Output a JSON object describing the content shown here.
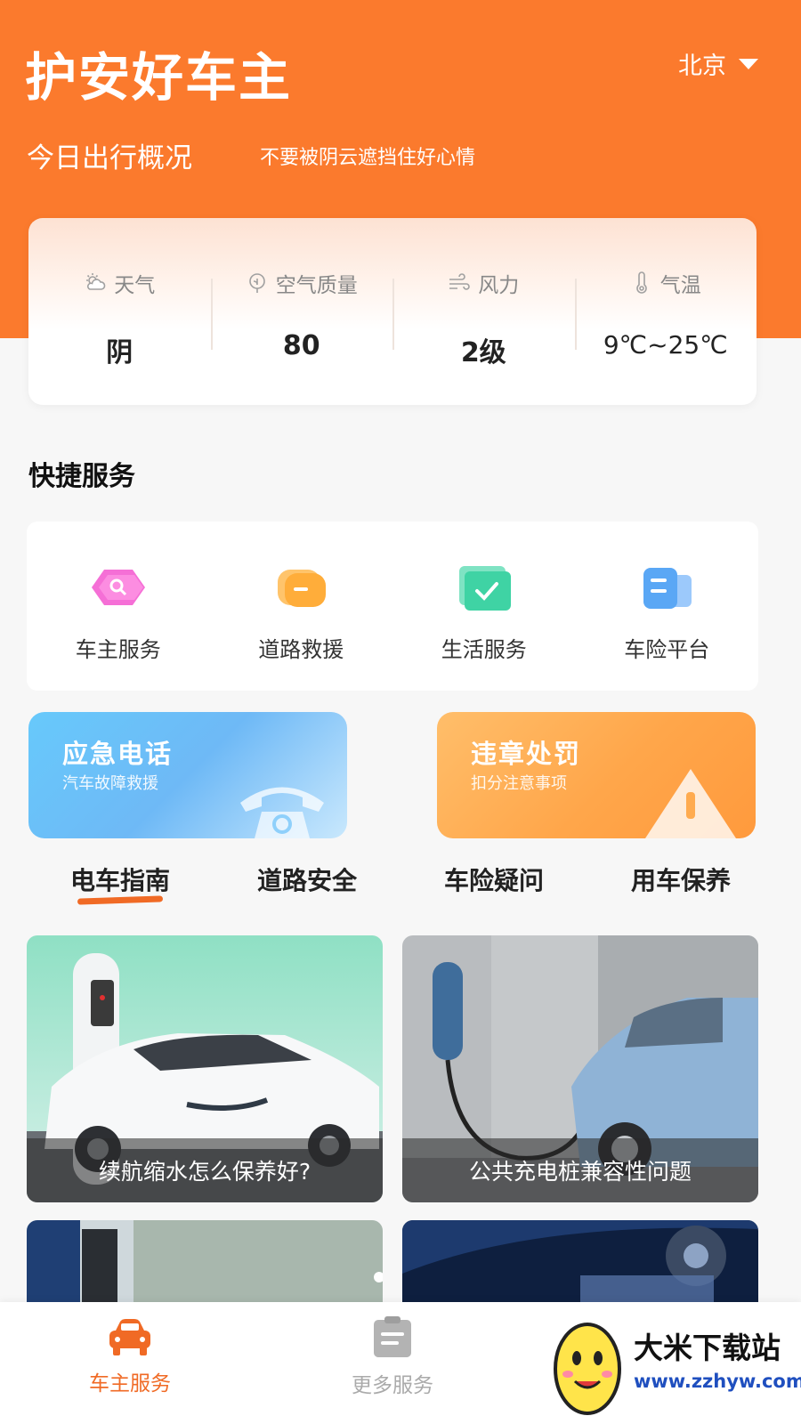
{
  "header": {
    "app_title": "护安好车主",
    "city": "北京",
    "overview_title": "今日出行概况",
    "overview_subtitle": "不要被阴云遮挡住好心情"
  },
  "weather": [
    {
      "label": "天气",
      "value": "阴",
      "icon": "cloud-sun-icon"
    },
    {
      "label": "空气质量",
      "value": "80",
      "icon": "leaf-icon"
    },
    {
      "label": "风力",
      "value": "2级",
      "icon": "wind-icon"
    },
    {
      "label": "气温",
      "value": "9℃~25℃",
      "icon": "thermometer-icon"
    }
  ],
  "quick_services": {
    "title": "快捷服务",
    "items": [
      {
        "label": "车主服务",
        "icon": "car-owner-service-icon",
        "color": "#f56fd6"
      },
      {
        "label": "道路救援",
        "icon": "road-rescue-icon",
        "color": "#ffad3a"
      },
      {
        "label": "生活服务",
        "icon": "life-service-icon",
        "color": "#3fd3a4"
      },
      {
        "label": "车险平台",
        "icon": "insurance-platform-icon",
        "color": "#5aa7f5"
      }
    ]
  },
  "banners": [
    {
      "title": "应急电话",
      "subtitle": "汽车故障救援",
      "icon": "telephone-icon"
    },
    {
      "title": "违章处罚",
      "subtitle": "扣分注意事项",
      "icon": "warning-triangle-icon"
    }
  ],
  "tabs": [
    "电车指南",
    "道路安全",
    "车险疑问",
    "用车保养"
  ],
  "articles": [
    {
      "caption": "续航缩水怎么保养好?"
    },
    {
      "caption": "公共充电桩兼容性问题"
    },
    {
      "caption": ""
    },
    {
      "caption": ""
    }
  ],
  "bottom_nav": [
    {
      "label": "车主服务",
      "icon": "car-icon"
    },
    {
      "label": "更多服务",
      "icon": "clipboard-icon"
    }
  ],
  "watermark": {
    "title": "大米下载站",
    "url": "www.zzhyw.com"
  },
  "colors": {
    "brand_orange": "#fb7a2d",
    "active_tab": "#f06a25"
  }
}
